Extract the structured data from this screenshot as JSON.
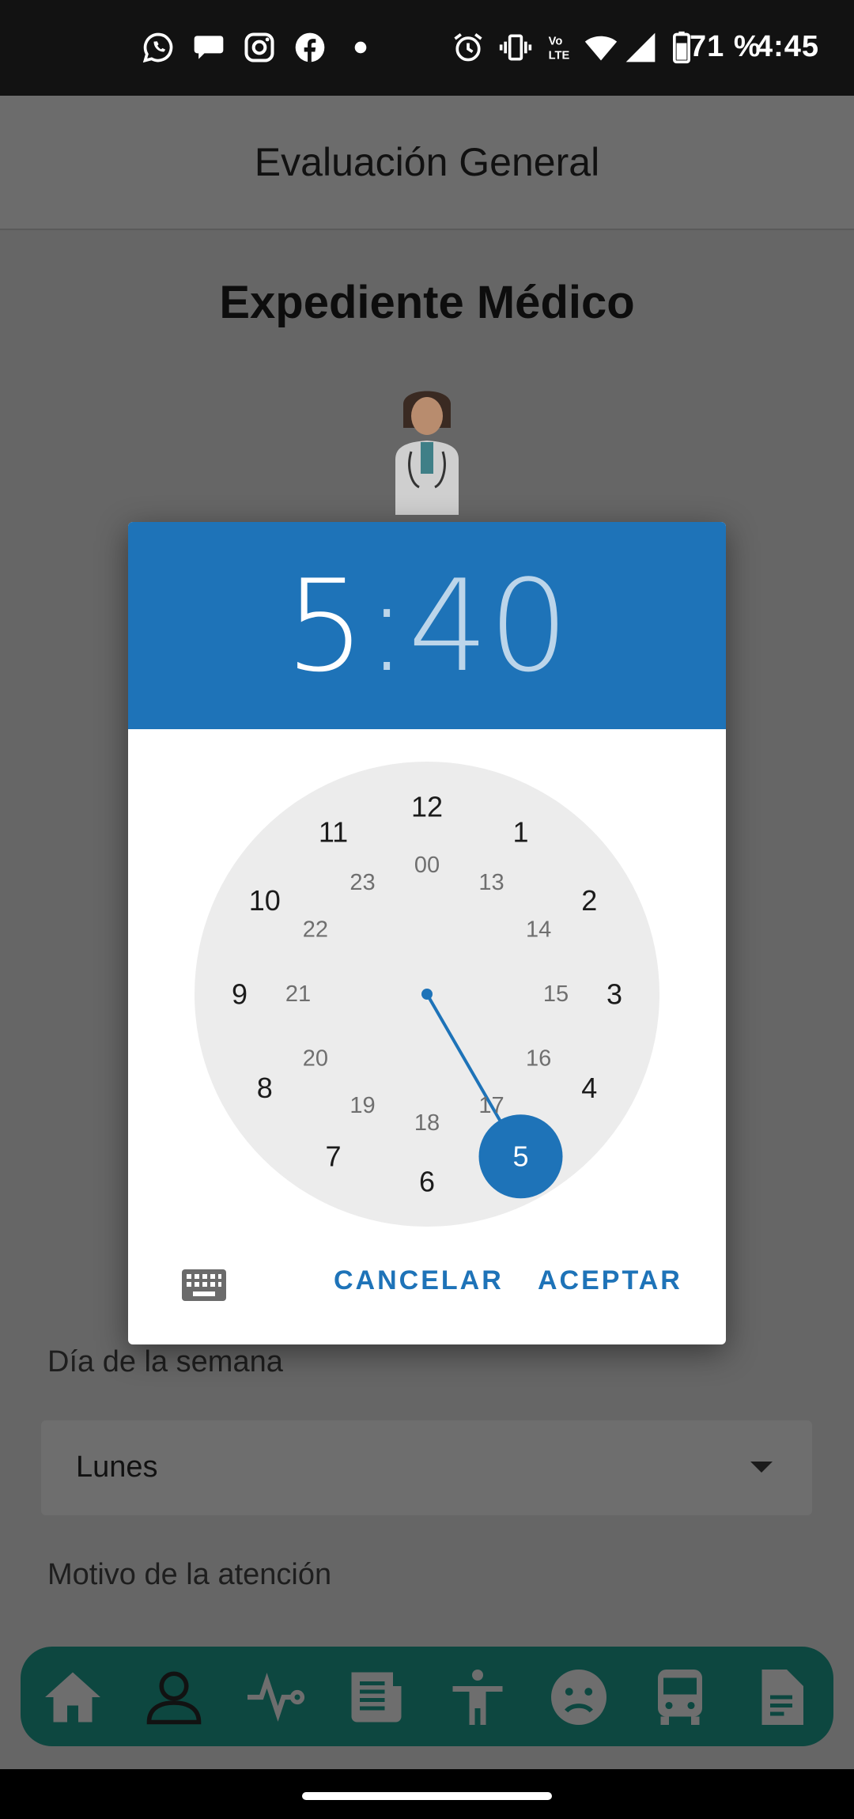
{
  "status_bar": {
    "battery": "71 %",
    "time": "4:45",
    "icons": [
      "whatsapp-icon",
      "chat-bubble-icon",
      "instagram-icon",
      "facebook-icon",
      "dot-icon",
      "alarm-icon",
      "vibrate-icon",
      "volte-icon",
      "wifi-icon",
      "signal-icon",
      "battery-icon"
    ]
  },
  "app_bar": {
    "title": "Evaluación General"
  },
  "page": {
    "heading": "Expediente Médico",
    "weekday_label": "Día de la semana",
    "weekday_value": "Lunes",
    "reason_label": "Motivo de la atención"
  },
  "time_picker": {
    "hour": "5",
    "separator": ":",
    "minutes": "40",
    "selected_hour": "5",
    "outer_hours": [
      "12",
      "1",
      "2",
      "3",
      "4",
      "5",
      "6",
      "7",
      "8",
      "9",
      "10",
      "11"
    ],
    "inner_hours": [
      "00",
      "13",
      "14",
      "15",
      "16",
      "17",
      "18",
      "19",
      "20",
      "21",
      "22",
      "23"
    ],
    "cancel_label": "CANCELAR",
    "accept_label": "ACEPTAR",
    "accent_color": "#1e73b8",
    "face_color": "#ececec"
  },
  "bottom_nav": {
    "items": [
      "home-icon",
      "person-icon",
      "vital-signs-icon",
      "newspaper-icon",
      "accessibility-icon",
      "sad-face-icon",
      "bus-icon",
      "document-icon"
    ],
    "selected": "person-icon",
    "background": "#0d4740"
  }
}
